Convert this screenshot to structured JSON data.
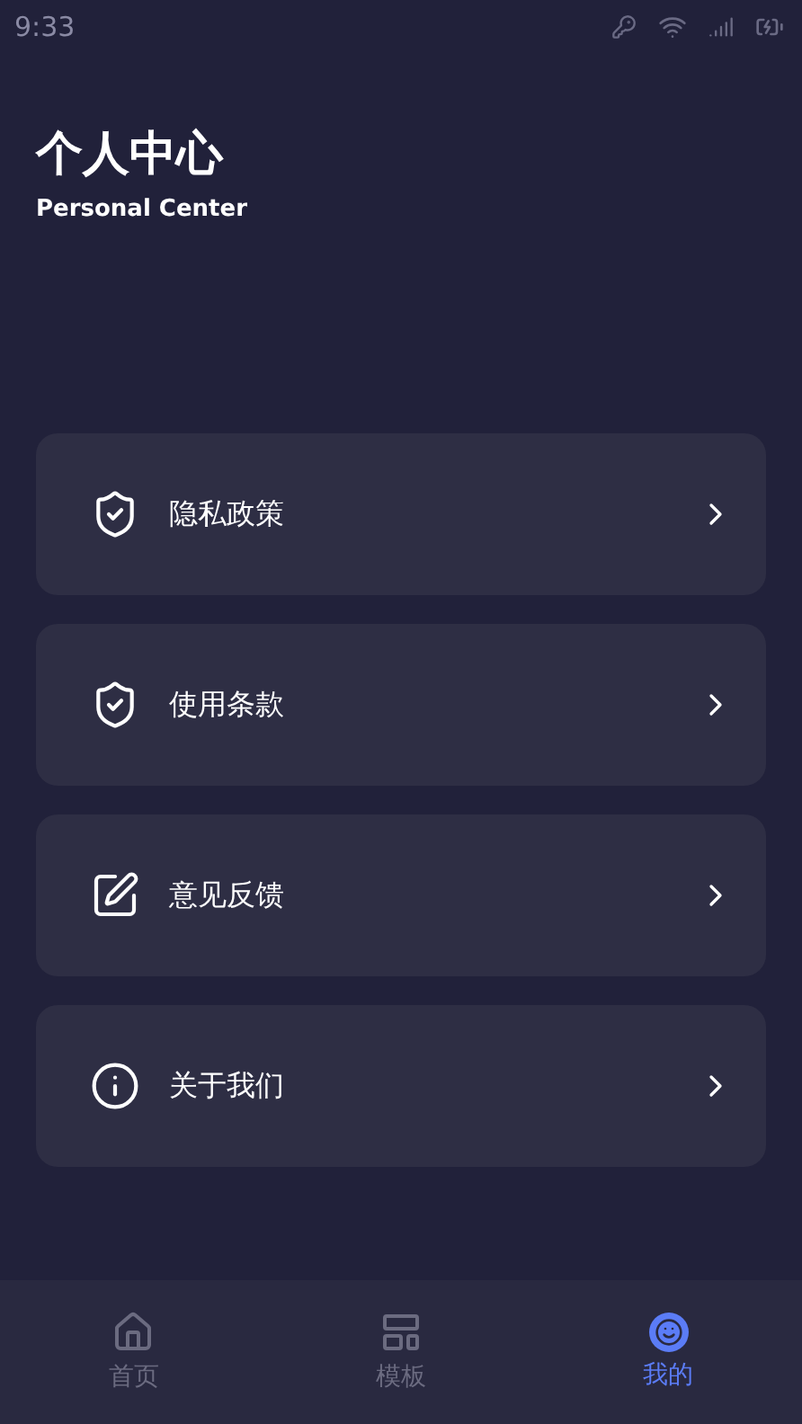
{
  "status_bar": {
    "time": "9:33"
  },
  "header": {
    "title": "个人中心",
    "subtitle": "Personal Center"
  },
  "menu": [
    {
      "label": "隐私政策",
      "kind": "shield"
    },
    {
      "label": "使用条款",
      "kind": "shield"
    },
    {
      "label": "意见反馈",
      "kind": "edit"
    },
    {
      "label": "关于我们",
      "kind": "info"
    }
  ],
  "tabs": [
    {
      "label": "首页",
      "kind": "home",
      "selected": false
    },
    {
      "label": "模板",
      "kind": "template",
      "selected": false
    },
    {
      "label": "我的",
      "kind": "me",
      "selected": true
    }
  ]
}
